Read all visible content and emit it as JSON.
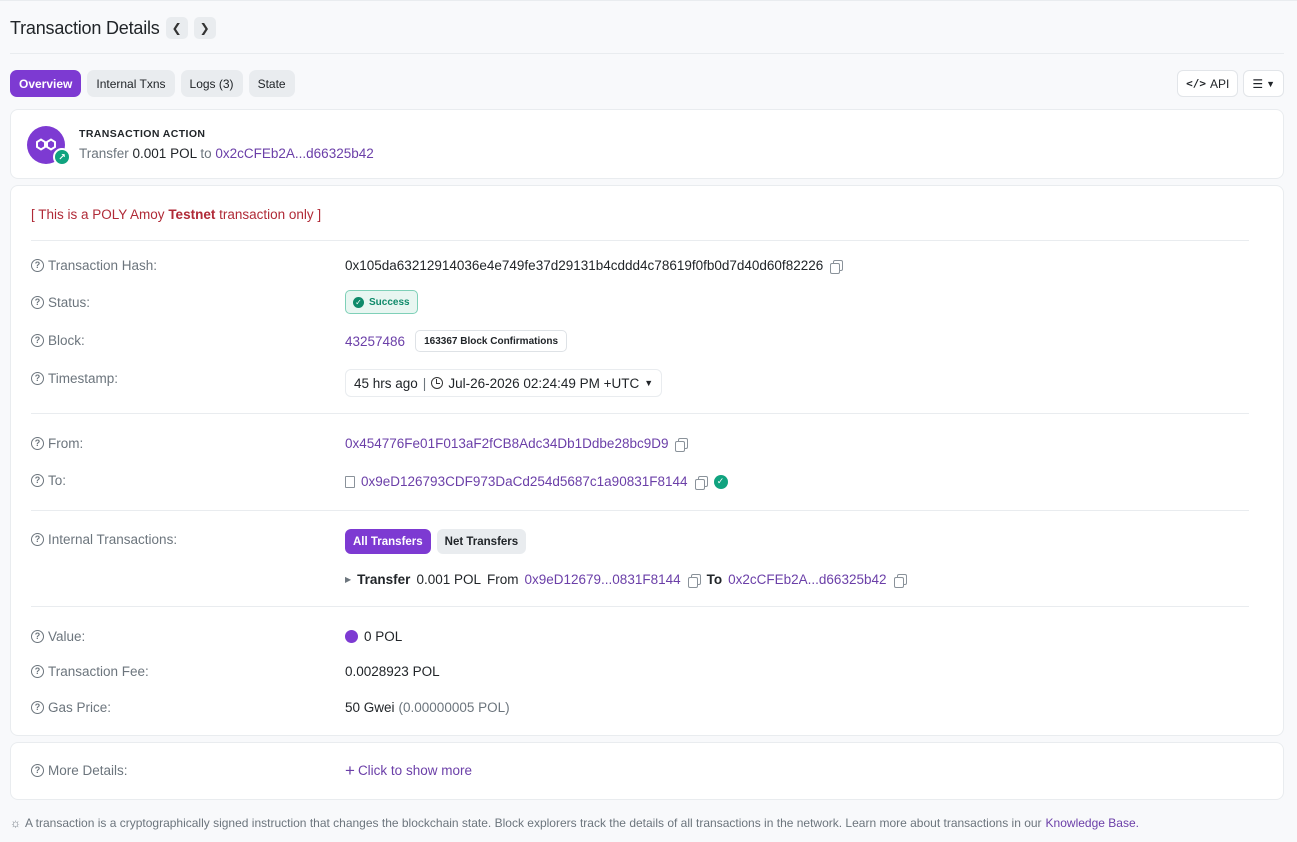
{
  "header": {
    "title": "Transaction Details",
    "prev_icon": "chevron-left-icon",
    "next_icon": "chevron-right-icon"
  },
  "tabs": [
    {
      "label": "Overview",
      "active": true
    },
    {
      "label": "Internal Txns",
      "active": false
    },
    {
      "label": "Logs (3)",
      "active": false
    },
    {
      "label": "State",
      "active": false
    }
  ],
  "toolbar": {
    "api_label": "API",
    "api_icon": "code-icon",
    "filter_icon": "list-filter-icon"
  },
  "action": {
    "label": "TRANSACTION ACTION",
    "verb": "Transfer",
    "amount": "0.001 POL",
    "to_word": "to",
    "to_address": "0x2cCFEb2A...d66325b42"
  },
  "testnet_note": {
    "prefix": "[ This is a POLY Amoy ",
    "bold": "Testnet",
    "suffix": " transaction only ]"
  },
  "rows": {
    "hash": {
      "label": "Transaction Hash:",
      "value": "0x105da63212914036e4e749fe37d29131b4cddd4c78619f0fb0d7d40d60f82226"
    },
    "status": {
      "label": "Status:",
      "value": "Success"
    },
    "block": {
      "label": "Block:",
      "value": "43257486",
      "confirmations": "163367 Block Confirmations"
    },
    "timestamp": {
      "label": "Timestamp:",
      "ago": "45 hrs ago",
      "sep": "|",
      "date": "Jul-26-2026 02:24:49 PM +UTC"
    },
    "from": {
      "label": "From:",
      "value": "0x454776Fe01F013aF2fCB8Adc34Db1Ddbe28bc9D9"
    },
    "to": {
      "label": "To:",
      "value": "0x9eD126793CDF973DaCd254d5687c1a90831F8144"
    },
    "internal": {
      "label": "Internal Transactions:",
      "all_label": "All Transfers",
      "net_label": "Net Transfers",
      "verb": "Transfer",
      "amount": "0.001 POL",
      "from_word": "From",
      "from_addr": "0x9eD12679...0831F8144",
      "to_word": "To",
      "to_addr": "0x2cCFEb2A...d66325b42"
    },
    "value": {
      "label": "Value:",
      "value": "0 POL"
    },
    "fee": {
      "label": "Transaction Fee:",
      "value": "0.0028923 POL"
    },
    "gas": {
      "label": "Gas Price:",
      "value": "50 Gwei",
      "sub": "(0.00000005 POL)"
    }
  },
  "more": {
    "label": "More Details:",
    "link": "Click to show more"
  },
  "footer": {
    "text": "A transaction is a cryptographically signed instruction that changes the blockchain state. Block explorers track the details of all transactions in the network. Learn more about transactions in our",
    "link": "Knowledge Base."
  },
  "colors": {
    "accent": "#7d3ad2",
    "link": "#6b3fa8",
    "success": "#0f8a6a",
    "warning": "#b02a37"
  }
}
